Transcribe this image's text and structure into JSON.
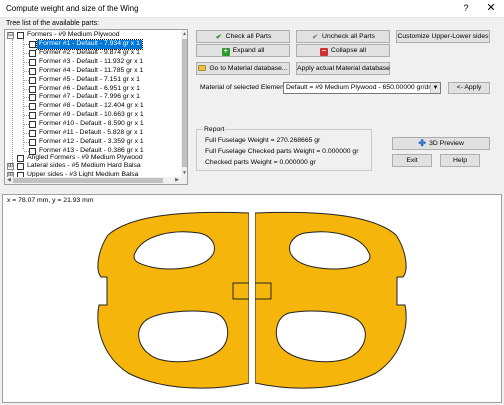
{
  "window": {
    "title": "Compute weight and size of the Wing",
    "help_glyph": "?",
    "close_glyph": "✕"
  },
  "tree": {
    "label": "Tree list of the available parts:",
    "root": {
      "expander": "⊟",
      "label": "Formers - #9 Medium Plywood"
    },
    "children": [
      {
        "label": "Former #1 - Default - 7.934 gr x 1",
        "selected": true
      },
      {
        "label": "Former #2 - Default - 9.874 gr x 1"
      },
      {
        "label": "Former #3 - Default - 11.932 gr x 1"
      },
      {
        "label": "Former #4 - Default - 11.785 gr x 1"
      },
      {
        "label": "Former #5 - Default - 7.151 gr x 1"
      },
      {
        "label": "Former #6 - Default - 6.951 gr x 1"
      },
      {
        "label": "Former #7 - Default - 7.996 gr x 1"
      },
      {
        "label": "Former #8 - Default - 12.404 gr x 1"
      },
      {
        "label": "Former #9 - Default - 10.663 gr x 1"
      },
      {
        "label": "Former #10 - Default - 8.590 gr x 1"
      },
      {
        "label": "Former #11 - Default - 5.828 gr x 1"
      },
      {
        "label": "Former #12 - Default - 3.359 gr x 1"
      },
      {
        "label": "Former #13 - Default - 0.386 gr x 1"
      }
    ],
    "others": [
      {
        "expander": "",
        "label": "Angled Formers - #9 Medium Plywood"
      },
      {
        "expander": "⊞",
        "label": "Lateral sides - #5 Medium Hard Balsa"
      },
      {
        "expander": "⊞",
        "label": "Upper sides - #3 Light Medium Balsa"
      }
    ]
  },
  "buttons": {
    "check_all": "Check all Parts",
    "uncheck_all": "Uncheck all Parts",
    "customize": "Customize Upper-Lower sides",
    "expand_all": "Expand all",
    "collapse_all": "Collapse all",
    "goto_material": "Go to Material database...",
    "apply_actual": "Apply actual Material database",
    "apply": "<- Apply",
    "preview_3d": "3D Preview",
    "exit": "Exit",
    "help": "Help"
  },
  "material": {
    "label": "Material of selected Element:",
    "selected": "Default = #9 Medium Plywood - 650.00000 gr/dmc"
  },
  "report": {
    "title": "Report",
    "full_weight": "Full Fuselage Weight = 270.268665 gr",
    "checked_weight": "Full Fuselage Checked parts Weight = 0.000000 gr",
    "checked_parts": "Checked parts Weight = 0.000000 gr"
  },
  "canvas": {
    "coords": "x = 78.07 mm, y = 21.93 mm",
    "part_fill": "#f5b50a",
    "part_stroke": "#222222"
  },
  "colors": {
    "selection": "#0078d7",
    "window_bg": "#f0f0f0"
  }
}
